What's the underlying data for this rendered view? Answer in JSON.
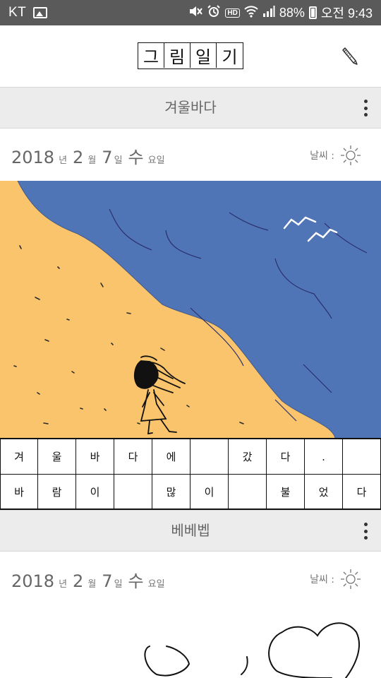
{
  "status_bar": {
    "carrier": "KT",
    "battery": "88%",
    "time": "오전 9:43",
    "hd_label": "HD",
    "icons": [
      "image-icon",
      "mute-icon",
      "alarm-icon",
      "hd-icon",
      "wifi-icon",
      "signal-icon",
      "battery-icon"
    ]
  },
  "app": {
    "title_chars": [
      "그",
      "림",
      "일",
      "기"
    ],
    "edit_icon": "pencil-icon"
  },
  "entries": [
    {
      "title": "겨울바다",
      "menu_icon": "more-vert-icon",
      "date": {
        "year": "2018",
        "year_unit": "년",
        "month": "2",
        "month_unit": "월",
        "day": "7",
        "day_unit": "일",
        "weekday": "수",
        "weekday_unit": "요일"
      },
      "weather_label": "날씨 :",
      "weather_icon": "sun-icon",
      "drawing_colors": {
        "sea": "#4f75b6",
        "sand": "#f9c46b",
        "ink": "#111111",
        "waves": "#2b2f6e",
        "gulls": "#ffffff"
      },
      "grid": [
        [
          "겨",
          "울",
          "바",
          "다",
          "에",
          "",
          "갔",
          "다",
          "."
        ],
        [
          "바",
          "람",
          "이",
          "",
          "많",
          "이",
          "",
          "불",
          "었",
          "다"
        ]
      ]
    },
    {
      "title": "베베벱",
      "menu_icon": "more-vert-icon",
      "date": {
        "year": "2018",
        "year_unit": "년",
        "month": "2",
        "month_unit": "월",
        "day": "7",
        "day_unit": "일",
        "weekday": "수",
        "weekday_unit": "요일"
      },
      "weather_label": "날씨 :",
      "weather_icon": "sun-icon"
    }
  ]
}
